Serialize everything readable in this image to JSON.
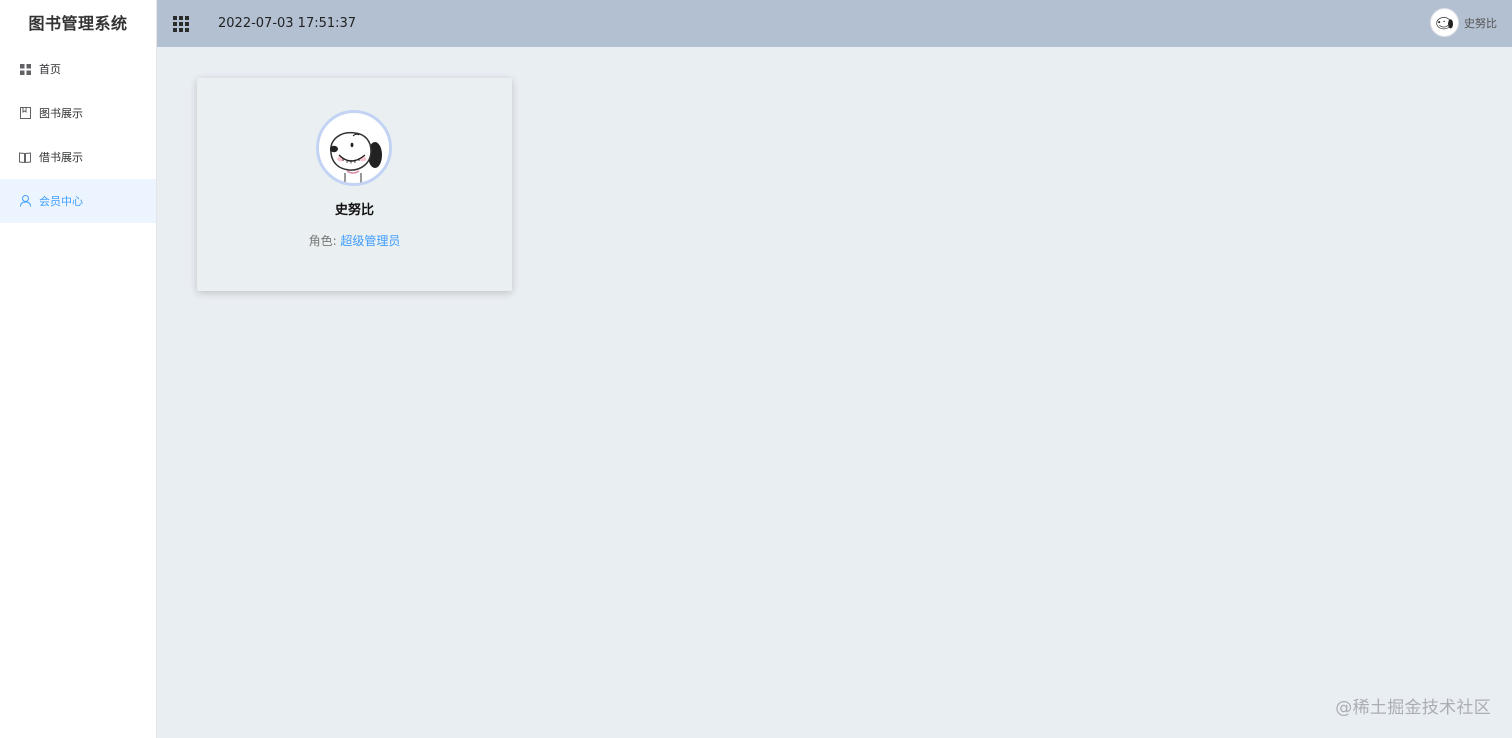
{
  "app": {
    "title": "图书管理系统"
  },
  "sidebar": {
    "items": [
      {
        "label": "首页",
        "icon": "grid-icon",
        "active": false
      },
      {
        "label": "图书展示",
        "icon": "book-icon",
        "active": false
      },
      {
        "label": "借书展示",
        "icon": "open-book-icon",
        "active": false
      },
      {
        "label": "会员中心",
        "icon": "user-icon",
        "active": true
      }
    ]
  },
  "header": {
    "menu_icon": "apps-grid-icon",
    "datetime": "2022-07-03 17:51:37",
    "username": "史努比",
    "avatar_icon": "snoopy-avatar-icon"
  },
  "profile": {
    "name": "史努比",
    "role_label": "角色: ",
    "role_value": "超级管理员",
    "avatar_icon": "snoopy-avatar-icon"
  },
  "watermark": "@稀土掘金技术社区",
  "colors": {
    "header_bg": "#b3c0d1",
    "main_bg": "#e9eef3",
    "active_bg": "#ecf5ff",
    "accent": "#409eff"
  }
}
